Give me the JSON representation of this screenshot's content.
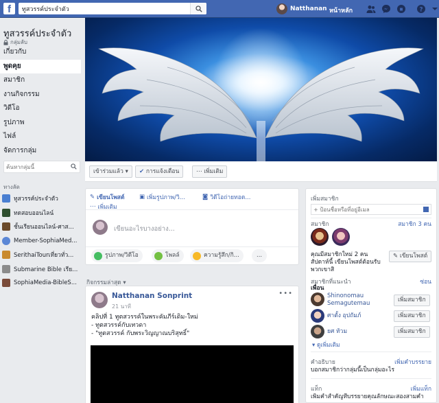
{
  "topbar": {
    "logo_letter": "f",
    "search_value": "ทูสวรรค์ประจำตัว",
    "user_name": "Natthanan",
    "home_label": "หน้าหลัก",
    "icons": [
      "friends-icon",
      "messenger-icon",
      "notifications-icon",
      "help-icon",
      "dropdown-icon"
    ]
  },
  "sidebar": {
    "group_name": "ทูสวรรค์ประจำตัว",
    "privacy": "กลุ่มลับ",
    "nav": [
      {
        "label": "เกี่ยวกับ"
      },
      {
        "label": "พูดคุย",
        "active": true
      },
      {
        "label": "สมาชิก"
      },
      {
        "label": "งานกิจกรรม"
      },
      {
        "label": "วิดีโอ"
      },
      {
        "label": "รูปภาพ"
      },
      {
        "label": "ไฟล์"
      },
      {
        "label": "จัดการกลุ่ม"
      }
    ],
    "search_placeholder": "ค้นหากลุ่มนี้",
    "shortcuts_heading": "ทางลัด",
    "shortcuts": [
      {
        "label": "ทูสวรรค์ประจำตัว",
        "color": "#4a7fd1"
      },
      {
        "label": "ทดสอบออนไลน์",
        "color": "#2f4f2f"
      },
      {
        "label": "ชั้นเรียนออนไลน์-ศาส...",
        "color": "#6b4a2a"
      },
      {
        "label": "Member-SophiaMed...",
        "color": "#5b87d6"
      },
      {
        "label": "SerithaiTourเที่ยวทั่ว...",
        "color": "#c98a2e"
      },
      {
        "label": "Submarine Bible เรีย...",
        "color": "#8b8b8b"
      },
      {
        "label": "SophiaMedia-BibleS...",
        "color": "#7a4b3a"
      }
    ]
  },
  "actions": {
    "joined": "เข้าร่วมแล้ว",
    "notifications": "การแจ้งเตือน",
    "more": "เพิ่มเติม"
  },
  "composer": {
    "tabs": [
      "เขียนโพสต์",
      "เพิ่มรูปภาพ/วิ...",
      "วิดีโอถ่ายทอด...",
      "เพิ่มเติม"
    ],
    "placeholder": "เขียนอะไรบางอย่าง...",
    "pills": [
      "รูปภาพ/วิดีโอ",
      "โพลล์",
      "ความรู้สึก/กิ...",
      "..."
    ]
  },
  "recent_label": "กิจกรรมล่าสุด",
  "post": {
    "author": "Natthanan Sonprint",
    "time": "21 นาที",
    "lines": [
      "คลิปที่ 1 ทูตสวรรค์ในพระคัมภีร์เดิม-ใหม่",
      "- ทูตสวรรค์กับเทวดา",
      "- \"ทูตสวรรค์ กับพระวิญญาณบริสุทธิ์\""
    ]
  },
  "right": {
    "add_members_heading": "เพิ่มสมาชิก",
    "add_members_placeholder": "+ ป้อนชื่อหรือที่อยู่อีเมล",
    "members_heading": "สมาชิก",
    "members_count": "สมาชิก 3 คน",
    "new_members_text": "คุณมีสมาชิกใหม่ 2 คน สัปดาห์นี้ เขียนโพสต์ต้อนรับพวกเขาสิ",
    "write_post_btn": "เขียนโพสต์",
    "suggested_heading": "สมาชิกที่แนะนำ",
    "hide_link": "ซ่อน",
    "friends_label": "เพื่อน",
    "suggestions": [
      {
        "name_line1": "Shinonomau",
        "name_line2": "Semagutemau",
        "btn": "เพิ่มสมาชิก"
      },
      {
        "name_line1": "ศาตั้ง อุปถัมภ์",
        "name_line2": "",
        "btn": "เพิ่มสมาชิก"
      },
      {
        "name_line1": "ยศ ท้วม",
        "name_line2": "",
        "btn": "เพิ่มสมาชิก"
      }
    ],
    "see_more": "ดูเพิ่มเติม",
    "description_heading": "คำอธิบาย",
    "add_description_link": "เพิ่มคำบรรยาย",
    "description_text": "บอกสมาชิกว่ากลุ่มนี้เป็นกลุ่มอะไร",
    "tags_heading": "แท็ก",
    "add_tags_link": "เพิ่มแท็ก",
    "tags_text": "เพิ่มคำสำคัญที่บรรยายคุณลักษณะสองสามคำ"
  }
}
